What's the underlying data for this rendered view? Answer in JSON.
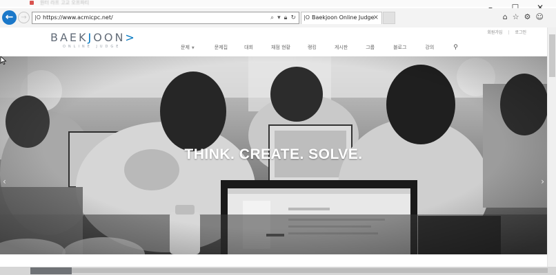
{
  "browser": {
    "blurred_title": "원터 라프 고교 오프파티",
    "url": "https://www.acmicpc.net/",
    "tab_title": "Baekjoon Online Judge"
  },
  "site": {
    "logo_prefix": "BAEK",
    "logo_accent": "J",
    "logo_suffix": "OON",
    "logo_tail": ">",
    "logo_sub": "ONLINE JUDGE",
    "util_links": [
      "회원가입",
      "로그인"
    ],
    "nav": [
      "문제",
      "문제집",
      "대회",
      "채점 현황",
      "랭킹",
      "게시판",
      "그룹",
      "블로그",
      "강의"
    ]
  },
  "hero": {
    "title": "THINK. CREATE. SOLVE."
  },
  "colors": {
    "brand_blue": "#0076c0",
    "back_button": "#1b78c9",
    "logo_gray": "#636c78"
  },
  "icons": [
    "back-arrow-icon",
    "forward-arrow-icon",
    "search-icon",
    "lock-icon",
    "refresh-icon",
    "close-icon",
    "home-icon",
    "star-icon",
    "gear-icon",
    "smiley-icon",
    "chevron-left-icon",
    "chevron-right-icon",
    "mouse-cursor-icon"
  ]
}
